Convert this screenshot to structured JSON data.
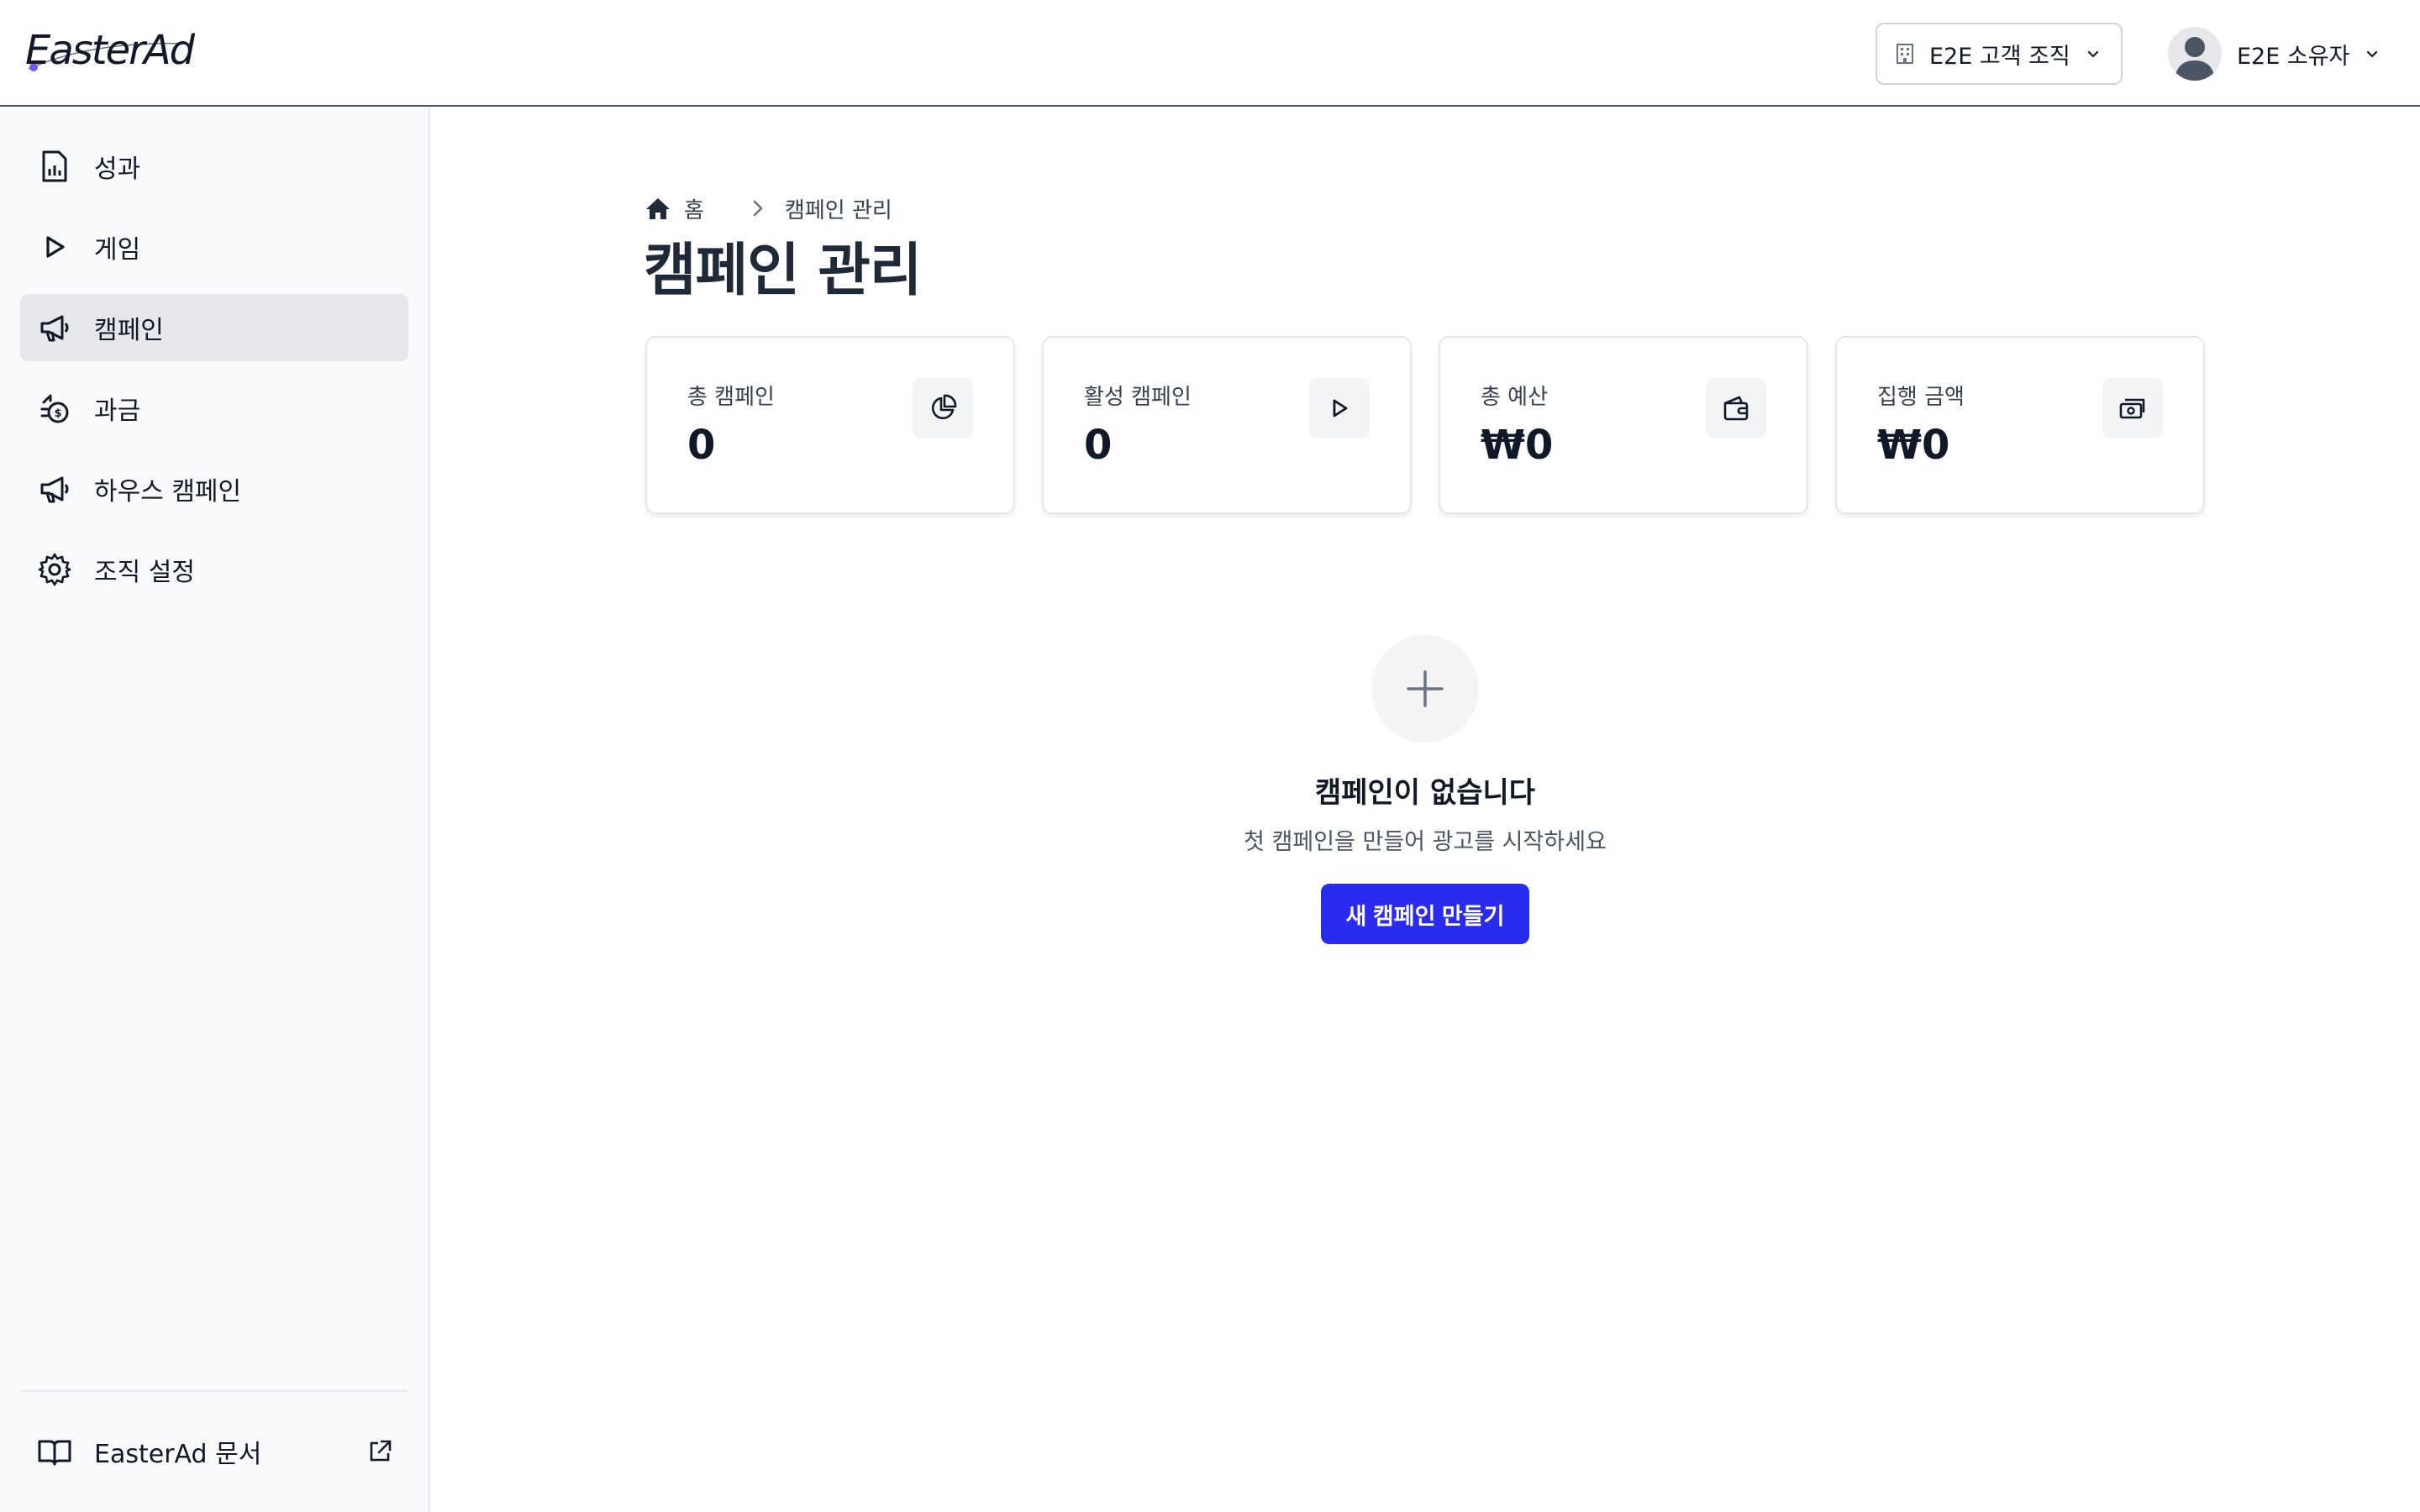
{
  "app": {
    "logo_text": "EasterAd"
  },
  "header": {
    "org_select_label": "E2E 고객 조직",
    "user_name": "E2E 소유자"
  },
  "sidebar": {
    "items": [
      {
        "label": "성과",
        "icon": "report-icon"
      },
      {
        "label": "게임",
        "icon": "play-icon"
      },
      {
        "label": "캠페인",
        "icon": "megaphone-icon",
        "active": true
      },
      {
        "label": "과금",
        "icon": "money-bag-icon"
      },
      {
        "label": "하우스 캠페인",
        "icon": "megaphone-icon"
      },
      {
        "label": "조직 설정",
        "icon": "gear-icon"
      }
    ],
    "docs_label": "EasterAd 문서"
  },
  "breadcrumb": {
    "home": "홈",
    "current": "캠페인 관리"
  },
  "page": {
    "title": "캠페인 관리"
  },
  "stats": [
    {
      "label": "총 캠페인",
      "value": "0",
      "icon": "pie-chart-icon"
    },
    {
      "label": "활성 캠페인",
      "value": "0",
      "icon": "play-icon"
    },
    {
      "label": "총 예산",
      "value": "₩0",
      "icon": "wallet-icon"
    },
    {
      "label": "집행 금액",
      "value": "₩0",
      "icon": "cash-icon"
    }
  ],
  "empty_state": {
    "title": "캠페인이 없습니다",
    "subtitle": "첫 캠페인을 만들어 광고를 시작하세요",
    "button_label": "새 캠페인 만들기"
  },
  "colors": {
    "primary": "#2b2bf0",
    "sidebar_active": "#e5e7eb"
  }
}
